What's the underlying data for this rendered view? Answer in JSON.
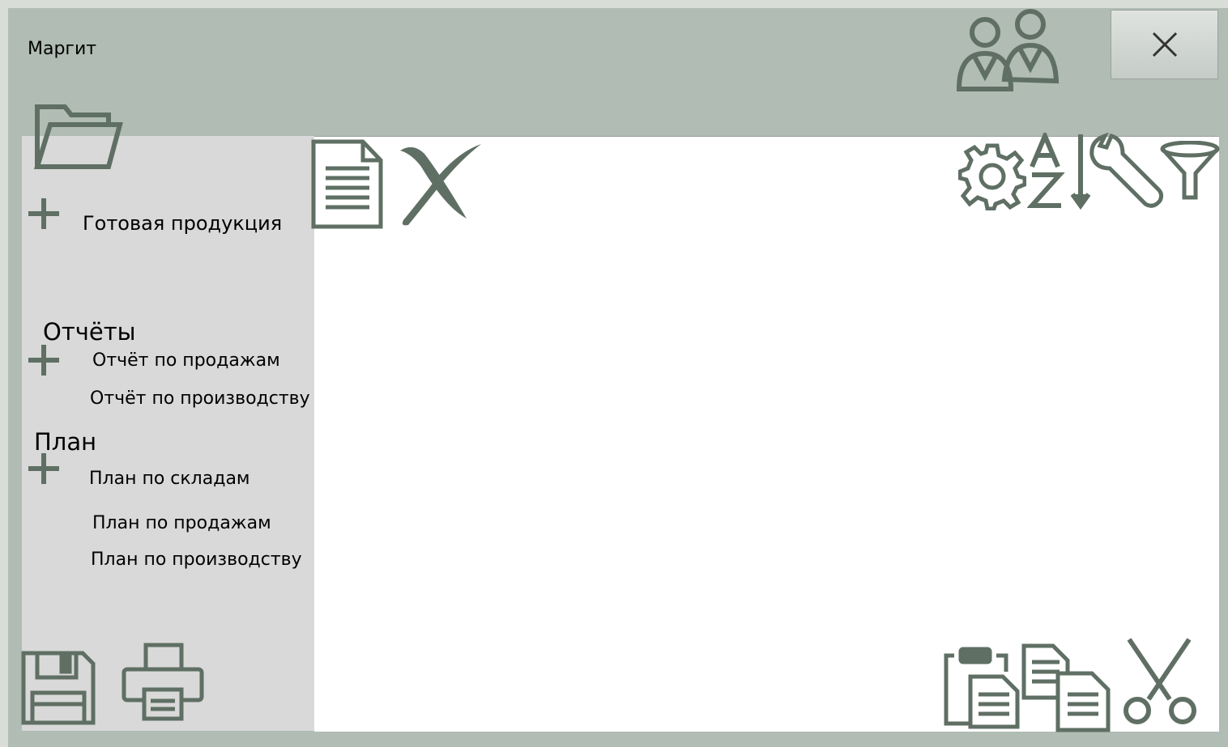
{
  "window": {
    "title": "Маргит"
  },
  "icons": {
    "close": "close-icon",
    "users": "users-icon",
    "folder": "folder-open-icon",
    "document": "document-icon",
    "delete": "delete-icon",
    "settings": "gear-icon",
    "sort": "sort-az-icon",
    "tools": "wrench-icon",
    "filter": "filter-icon",
    "save": "save-icon",
    "print": "printer-icon",
    "paste": "paste-icon",
    "copy": "copy-icon",
    "cut": "scissors-icon"
  },
  "sidebar": {
    "items": [
      {
        "label": "Готовая продукция"
      }
    ],
    "reports": {
      "heading": "Отчёты",
      "items": [
        {
          "label": "Отчёт по продажам"
        },
        {
          "label": "Отчёт по производству"
        }
      ]
    },
    "plan": {
      "heading": "План",
      "items": [
        {
          "label": "План по складам"
        },
        {
          "label": "План по продажам"
        },
        {
          "label": "План по производству"
        }
      ]
    }
  },
  "colors": {
    "window_bg": "#b0bcb4",
    "sidebar_bg": "#d9d9d9",
    "icon": "#5f6f64"
  }
}
